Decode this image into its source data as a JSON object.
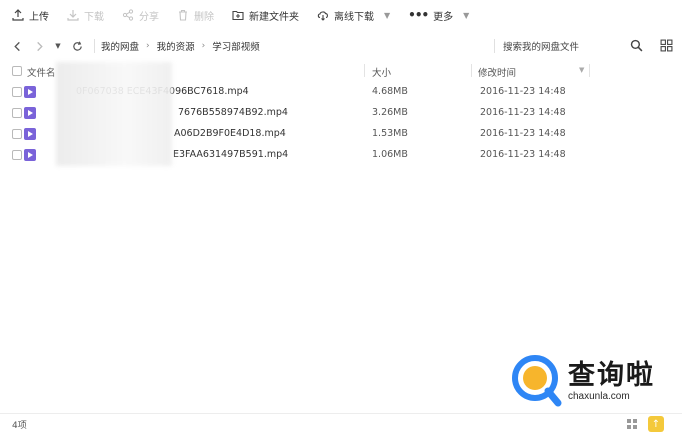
{
  "toolbar": {
    "upload": "上传",
    "download": "下载",
    "share": "分享",
    "delete": "删除",
    "new_folder": "新建文件夹",
    "offline_download": "离线下载",
    "more": "更多"
  },
  "nav": {
    "breadcrumb": [
      "我的网盘",
      "我的资源",
      "学习部视频"
    ],
    "search_placeholder": "搜索我的网盘文件"
  },
  "table": {
    "headers": {
      "name": "文件名",
      "size": "大小",
      "modified": "修改时间"
    },
    "rows": [
      {
        "name": "C0F067038ECE43F4096BC7618.mp4",
        "name_visible": "0F067038   ECE43F4096BC7618.mp4",
        "size": "4.68MB",
        "modified": "2016-11-23 14:48"
      },
      {
        "name": "7676B558974B92.mp4",
        "name_visible": "7676B558974B92.mp4",
        "size": "3.26MB",
        "modified": "2016-11-23 14:48"
      },
      {
        "name": "A06D2B9F0E4D18.mp4",
        "name_visible": "A06D2B9F0E4D18.mp4",
        "size": "1.53MB",
        "modified": "2016-11-23 14:48"
      },
      {
        "name": "E3FAA631497B591.mp4",
        "name_visible": "E3FAA631497B591.mp4",
        "size": "1.06MB",
        "modified": "2016-11-23 14:48"
      }
    ]
  },
  "status": {
    "count": "4项"
  },
  "watermark": {
    "title": "查询啦",
    "site": "chaxunla.com"
  },
  "colors": {
    "video_icon": "#7a63d9",
    "upload_badge": "#f4c93b",
    "watermark_blue": "#2e86f5"
  }
}
